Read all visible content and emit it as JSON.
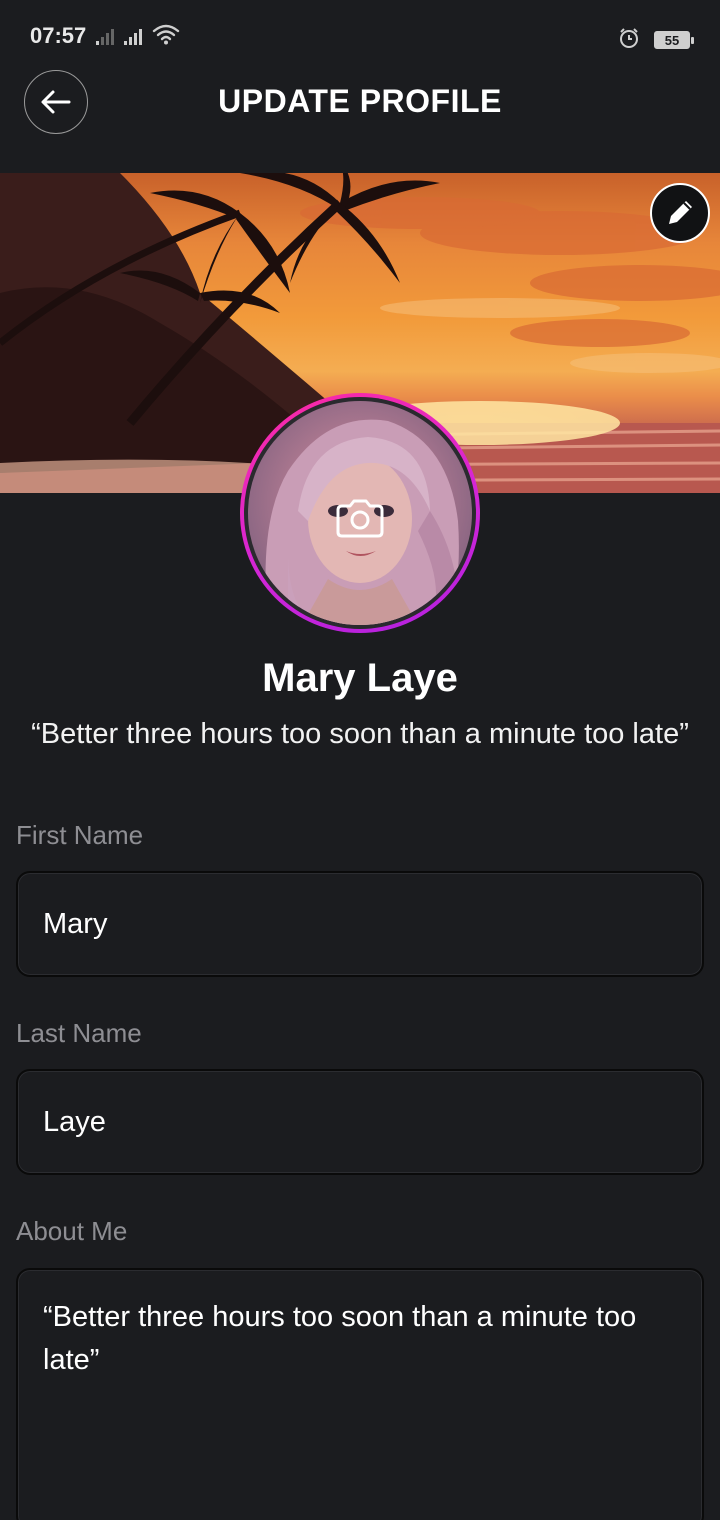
{
  "status_bar": {
    "time": "07:57",
    "battery": "55",
    "icons": [
      "signal-weak-icon",
      "signal-strong-icon",
      "wifi-icon",
      "alarm-icon",
      "battery-icon"
    ]
  },
  "header": {
    "title": "UPDATE PROFILE",
    "back_icon": "arrow-left-icon"
  },
  "cover": {
    "edit_icon": "pencil-icon"
  },
  "avatar": {
    "camera_icon": "camera-icon"
  },
  "profile": {
    "name": "Mary Laye",
    "bio": "“Better three hours too soon than a minute too late”"
  },
  "form": {
    "first_name": {
      "label": "First Name",
      "value": "Mary"
    },
    "last_name": {
      "label": "Last Name",
      "value": "Laye"
    },
    "about_me": {
      "label": "About Me",
      "value": "“Better three hours too soon than a minute too late”"
    }
  },
  "colors": {
    "background": "#1b1c1f",
    "label": "#8e8e93",
    "avatar_ring": "#d426d6"
  }
}
